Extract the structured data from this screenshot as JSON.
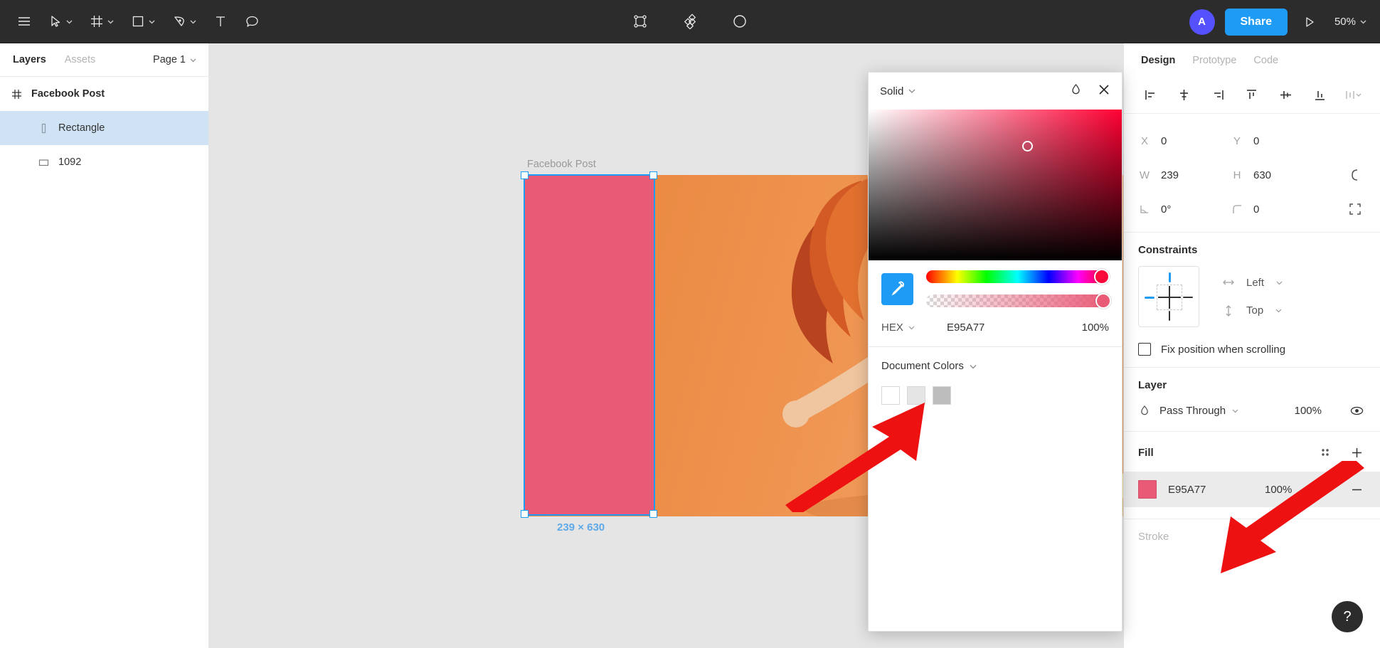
{
  "toolbar": {
    "menu_icon": "hamburger-menu-icon",
    "tools": [
      {
        "name": "move-tool",
        "icon": "cursor-arrow-icon",
        "caret": true
      },
      {
        "name": "frame-tool",
        "icon": "frame-grid-icon",
        "caret": true
      },
      {
        "name": "shape-tool",
        "icon": "square-icon",
        "caret": true
      },
      {
        "name": "pen-tool",
        "icon": "pen-nib-icon",
        "caret": true
      },
      {
        "name": "text-tool",
        "icon": "text-t-icon",
        "caret": false
      },
      {
        "name": "comment-tool",
        "icon": "comment-bubble-icon",
        "caret": false
      }
    ],
    "center_tools": [
      {
        "name": "component-tool",
        "icon": "component-nodes-icon"
      },
      {
        "name": "plugins-tool",
        "icon": "diamond-grid-icon"
      },
      {
        "name": "mask-tool",
        "icon": "contrast-circle-icon"
      }
    ],
    "avatar_initial": "A",
    "share_label": "Share",
    "present_icon": "play-triangle-icon",
    "zoom_level": "50%"
  },
  "left_panel": {
    "tabs": [
      {
        "label": "Layers",
        "active": true
      },
      {
        "label": "Assets",
        "active": false
      }
    ],
    "page_selector": "Page 1",
    "layers": [
      {
        "label": "Facebook Post",
        "icon": "frame-hash-icon",
        "type": "frame",
        "selected": false
      },
      {
        "label": "Rectangle",
        "icon": "rectangle-slim-icon",
        "type": "child",
        "selected": true
      },
      {
        "label": "1092",
        "icon": "image-rect-icon",
        "type": "child",
        "selected": false
      }
    ]
  },
  "canvas": {
    "frame_label": "Facebook Post",
    "dimension_badge": "239 × 630",
    "selection_color": "#E95A77",
    "selection_outline": "#1E9CF5"
  },
  "color_picker": {
    "type_label": "Solid",
    "blend_icon": "droplet-icon",
    "close_icon": "close-x-icon",
    "eyedropper_icon": "eyedropper-icon",
    "hex_label": "HEX",
    "hex_value": "E95A77",
    "opacity": "100%",
    "document_colors_label": "Document Colors",
    "swatches": [
      "#FFFFFF",
      "#E5E5E5",
      "#BDBDBD"
    ]
  },
  "right_panel": {
    "tabs": [
      {
        "label": "Design",
        "active": true
      },
      {
        "label": "Prototype",
        "active": false
      },
      {
        "label": "Code",
        "active": false
      }
    ],
    "align_tools": [
      {
        "name": "align-left-icon"
      },
      {
        "name": "align-horizontal-center-icon"
      },
      {
        "name": "align-right-icon"
      },
      {
        "name": "align-top-icon"
      },
      {
        "name": "align-vertical-center-icon"
      },
      {
        "name": "align-bottom-icon"
      },
      {
        "name": "distribute-icon"
      }
    ],
    "properties": {
      "x_label": "X",
      "x_value": "0",
      "y_label": "Y",
      "y_value": "0",
      "w_label": "W",
      "w_value": "239",
      "h_label": "H",
      "h_value": "630",
      "rotation_value": "0°",
      "corner_radius_value": "0"
    },
    "constraints": {
      "title": "Constraints",
      "horizontal": "Left",
      "vertical": "Top",
      "fix_position_label": "Fix position when scrolling"
    },
    "layer": {
      "title": "Layer",
      "blend_mode": "Pass Through",
      "opacity": "100%"
    },
    "fill": {
      "title": "Fill",
      "hex": "E95A77",
      "opacity": "100%",
      "swatch_color": "#E95A77"
    },
    "stroke": {
      "title": "Stroke"
    }
  },
  "help": {
    "label": "?"
  }
}
